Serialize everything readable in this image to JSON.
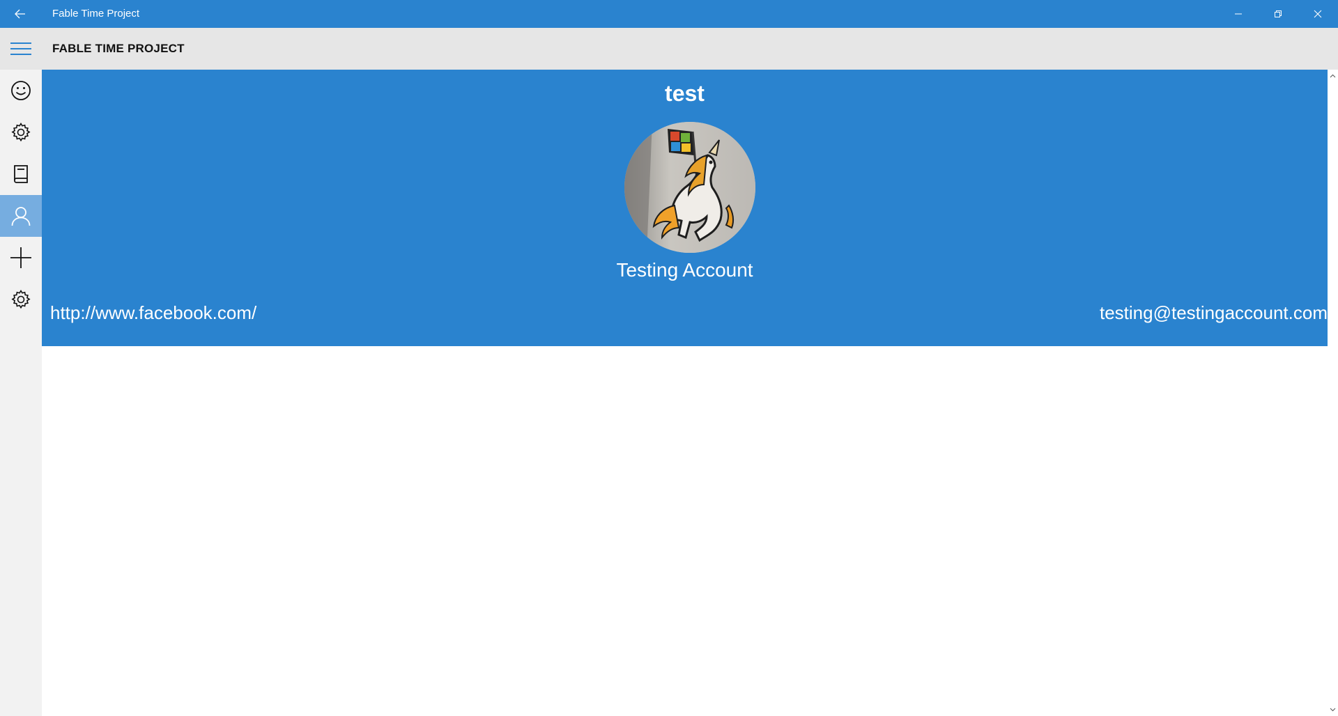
{
  "window": {
    "title": "Fable Time Project",
    "controls": [
      "minimize-icon",
      "restore-icon",
      "close-icon"
    ],
    "accent": "#2a83cf"
  },
  "header": {
    "title": "FABLE TIME PROJECT",
    "menu_icon": "hamburger-icon"
  },
  "nav": {
    "items": [
      {
        "icon": "smiley-icon",
        "active": false
      },
      {
        "icon": "gear-icon",
        "active": false
      },
      {
        "icon": "book-icon",
        "active": false
      },
      {
        "icon": "person-icon",
        "active": true
      },
      {
        "icon": "plus-icon",
        "active": false
      },
      {
        "icon": "gear-icon",
        "active": false
      }
    ]
  },
  "profile": {
    "username": "test",
    "display_name": "Testing Account",
    "website": "http://www.facebook.com/",
    "email": "testing@testingaccount.com",
    "avatar_icon": "unicorn-sticker-photo",
    "edit_icon": "pencil-icon"
  }
}
